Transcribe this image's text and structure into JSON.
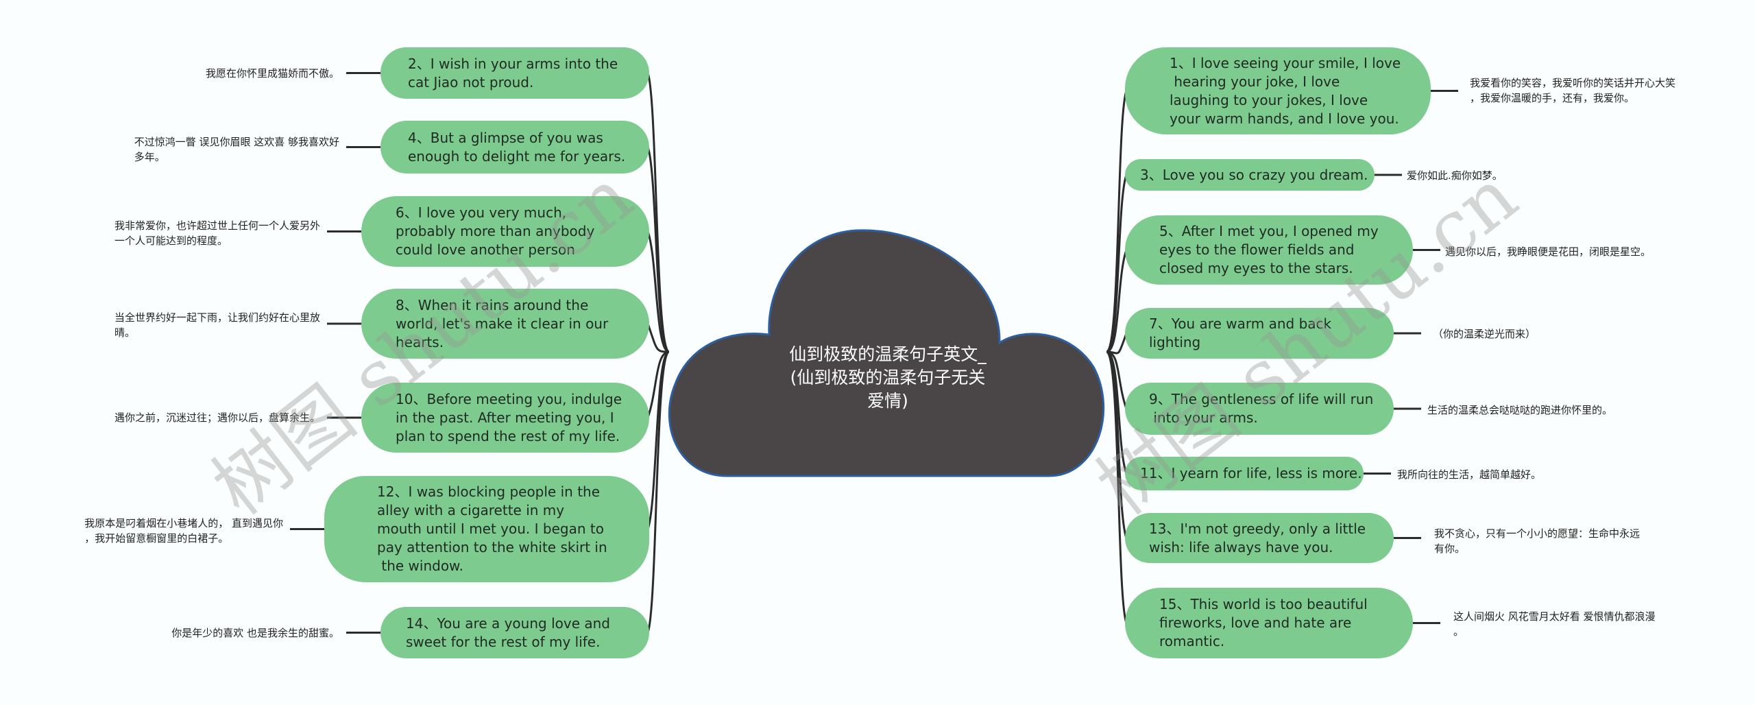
{
  "center": {
    "title": "仙到极致的温柔句子英文_\n(仙到极致的温柔句子无关\n爱情)"
  },
  "colors": {
    "node_fill": "#7ecb8f",
    "cloud_fill": "#4a4546",
    "cloud_stroke": "#2d5fa0",
    "connector": "#2b2b2b",
    "background": "#fbfefe"
  },
  "left_branches": [
    {
      "text": "2、I wish in your arms into the\ncat Jiao not proud.",
      "note": "我愿在你怀里成猫娇而不傲。"
    },
    {
      "text": "4、But a glimpse of you was\nenough to delight me for years.",
      "note": "不过惊鸿一瞥 误见你眉眼 这欢喜 够我喜欢好\n多年。"
    },
    {
      "text": "6、I love you very much,\nprobably more than anybody\ncould love another person",
      "note": "我非常爱你，也许超过世上任何一个人爱另外\n一个人可能达到的程度。"
    },
    {
      "text": "8、When it rains around the\nworld, let's make it clear in our\nhearts.",
      "note": "当全世界约好一起下雨，让我们约好在心里放\n晴。"
    },
    {
      "text": "10、Before meeting you, indulge\nin the past. After meeting you, I\nplan to spend the rest of my life.",
      "note": "遇你之前，沉迷过往；遇你以后，盘算余生。"
    },
    {
      "text": "12、I was blocking people in the\nalley with a cigarette in my\nmouth until I met you. I began to\npay attention to the white skirt in\n the window.",
      "note": "我原本是叼着烟在小巷堵人的， 直到遇见你\n，我开始留意橱窗里的白裙子。"
    },
    {
      "text": "14、You are a young love and\nsweet for the rest of my life.",
      "note": "你是年少的喜欢 也是我余生的甜蜜。"
    }
  ],
  "right_branches": [
    {
      "text": "1、I love seeing your smile, I love\n hearing your joke, I love\nlaughing to your jokes, I love\nyour warm hands, and I love you.",
      "note": "我爱看你的笑容，我爱听你的笑话并开心大笑\n，我爱你温暖的手，还有，我爱你。"
    },
    {
      "text": "3、Love you so crazy you dream.",
      "note": "爱你如此.痴你如梦。"
    },
    {
      "text": "5、After I met you, I opened my\neyes to the flower fields and\nclosed my eyes to the stars.",
      "note": "遇见你以后，我睁眼便是花田，闭眼是星空。"
    },
    {
      "text": "7、You are warm and back\nlighting",
      "note": "（你的温柔逆光而来）"
    },
    {
      "text": "9、The gentleness of life will run\n into your arms.",
      "note": "生活的温柔总会哒哒哒的跑进你怀里的。"
    },
    {
      "text": "11、I yearn for life, less is more.",
      "note": "我所向往的生活，越简单越好。"
    },
    {
      "text": "13、I'm not greedy, only a little\nwish: life always have you.",
      "note": "我不贪心，只有一个小小的愿望：生命中永远\n有你。"
    },
    {
      "text": "15、This world is too beautiful\nfireworks, love and hate are\nromantic.",
      "note": "这人间烟火 风花雪月太好看 爱恨情仇都浪漫\n。"
    }
  ],
  "watermarks": [
    "树图 shutu.cn",
    "树图 shutu.cn"
  ]
}
